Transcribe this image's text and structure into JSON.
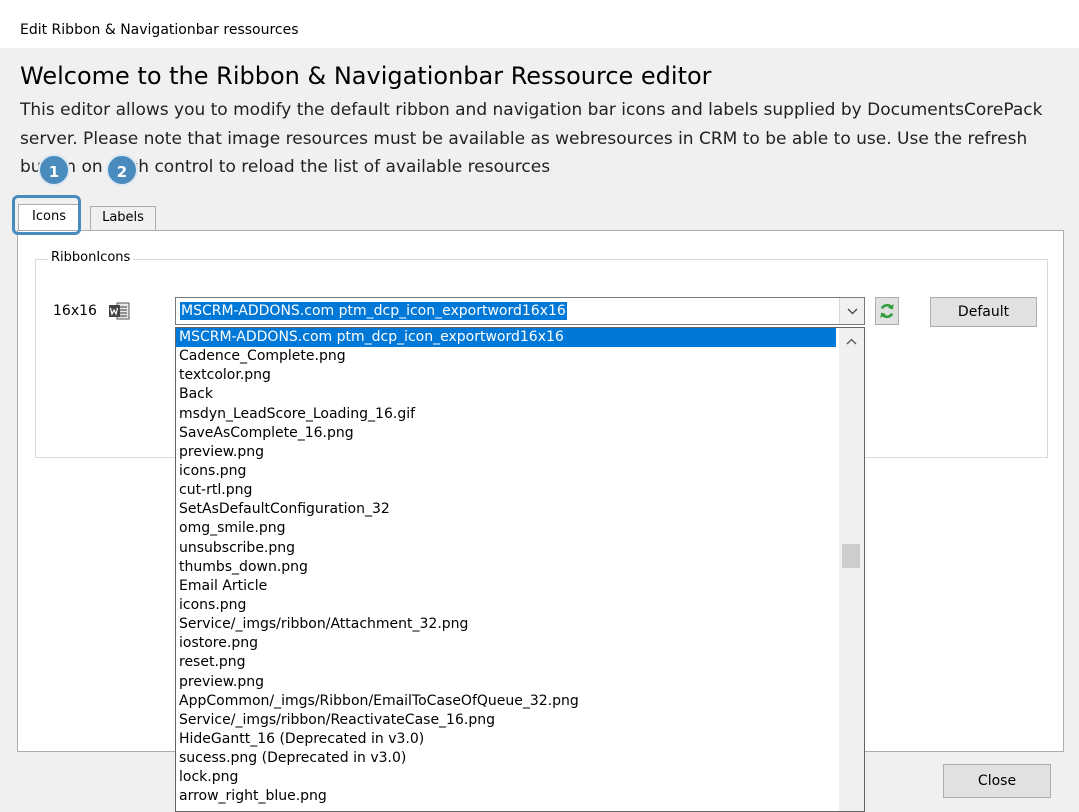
{
  "window": {
    "title": "Edit Ribbon & Navigationbar ressources"
  },
  "header": {
    "heading": "Welcome to the Ribbon & Navigationbar Ressource editor",
    "description": "This editor allows you to modify the default ribbon and navigation bar icons and labels supplied by DocumentsCorePack server. Please note that image resources must be available as webresources in CRM to be able to use. Use the refresh button on each control to reload the list of available resources"
  },
  "tabs": [
    {
      "label": "Icons",
      "selected": true
    },
    {
      "label": "Labels",
      "selected": false
    }
  ],
  "badges": [
    "1",
    "2"
  ],
  "group": {
    "legend": "RibbonIcons",
    "size_label": "16x16",
    "icon": "word-document-icon",
    "combo_value": "MSCRM-ADDONS.com ptm_dcp_icon_exportword16x16",
    "default_label": "Default",
    "refresh_icon": "refresh-icon"
  },
  "dropdown": {
    "items": [
      "MSCRM-ADDONS.com ptm_dcp_icon_exportword16x16",
      "Cadence_Complete.png",
      "textcolor.png",
      "Back",
      "msdyn_LeadScore_Loading_16.gif",
      "SaveAsComplete_16.png",
      "preview.png",
      "icons.png",
      "cut-rtl.png",
      "SetAsDefaultConfiguration_32",
      "omg_smile.png",
      "unsubscribe.png",
      "thumbs_down.png",
      "Email Article",
      "icons.png",
      "Service/_imgs/ribbon/Attachment_32.png",
      "iostore.png",
      "reset.png",
      "preview.png",
      "AppCommon/_imgs/Ribbon/EmailToCaseOfQueue_32.png",
      "Service/_imgs/ribbon/ReactivateCase_16.png",
      "HideGantt_16 (Deprecated in v3.0)",
      "sucess.png (Deprecated in v3.0)",
      "lock.png",
      "arrow_right_blue.png"
    ],
    "selected_index": 0
  },
  "footer": {
    "close_label": "Close"
  },
  "colors": {
    "accent": "#4a8bbd",
    "selection": "#0078d7",
    "refresh_green": "#2e9e3a"
  }
}
